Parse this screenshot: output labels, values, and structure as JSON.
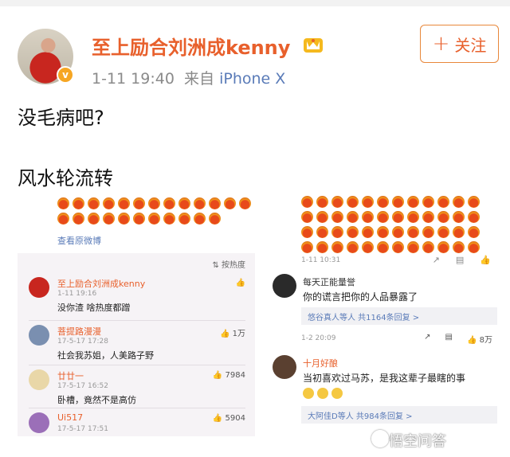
{
  "post": {
    "author": "至上励合刘洲成kenny",
    "timestamp": "1-11 19:40",
    "source_prefix": "来自",
    "device": "iPhone X",
    "follow_label": "关注",
    "follow_plus": "+",
    "verified_badge": "v",
    "text_line1": "没毛病吧?",
    "text_line2": "风水轮流转"
  },
  "left_image": {
    "view_original": "查看原微博",
    "sort_label": "按热度",
    "comments": [
      {
        "name": "至上励合刘洲成kenny",
        "date": "1-11 19:16",
        "text": "没你渣 啥热度都蹭",
        "likes": ""
      },
      {
        "name": "菩提路漫漫",
        "date": "17-5-17 17:28",
        "text": "社会我苏姐，人美路子野",
        "likes": "1万"
      },
      {
        "name": "廿廿一",
        "date": "17-5-17 16:52",
        "text": "卧槽，竟然不是高仿",
        "likes": "7984"
      },
      {
        "name": "Ui517",
        "date": "17-5-17 17:51",
        "text": "",
        "likes": "5904"
      }
    ]
  },
  "right_image": {
    "post_date": "1-11 10:31",
    "comments": [
      {
        "name": "每天正能量誉",
        "text": "你的谎言把你的人品暴露了",
        "reply": "悠谷真人等人  共1164条回复 >",
        "meta": "1-2 20:09",
        "likes": "8万"
      },
      {
        "name": "十月好酿",
        "text": "当初喜欢过马苏，是我这辈子最瞎的事",
        "reply": "大阿佳D等人  共984条回复 >",
        "meta": "",
        "likes": ""
      }
    ]
  },
  "watermark": "悟空问答",
  "colors": {
    "accent": "#e8602c",
    "link": "#5a7bb8",
    "follow_border": "#e8873a"
  }
}
